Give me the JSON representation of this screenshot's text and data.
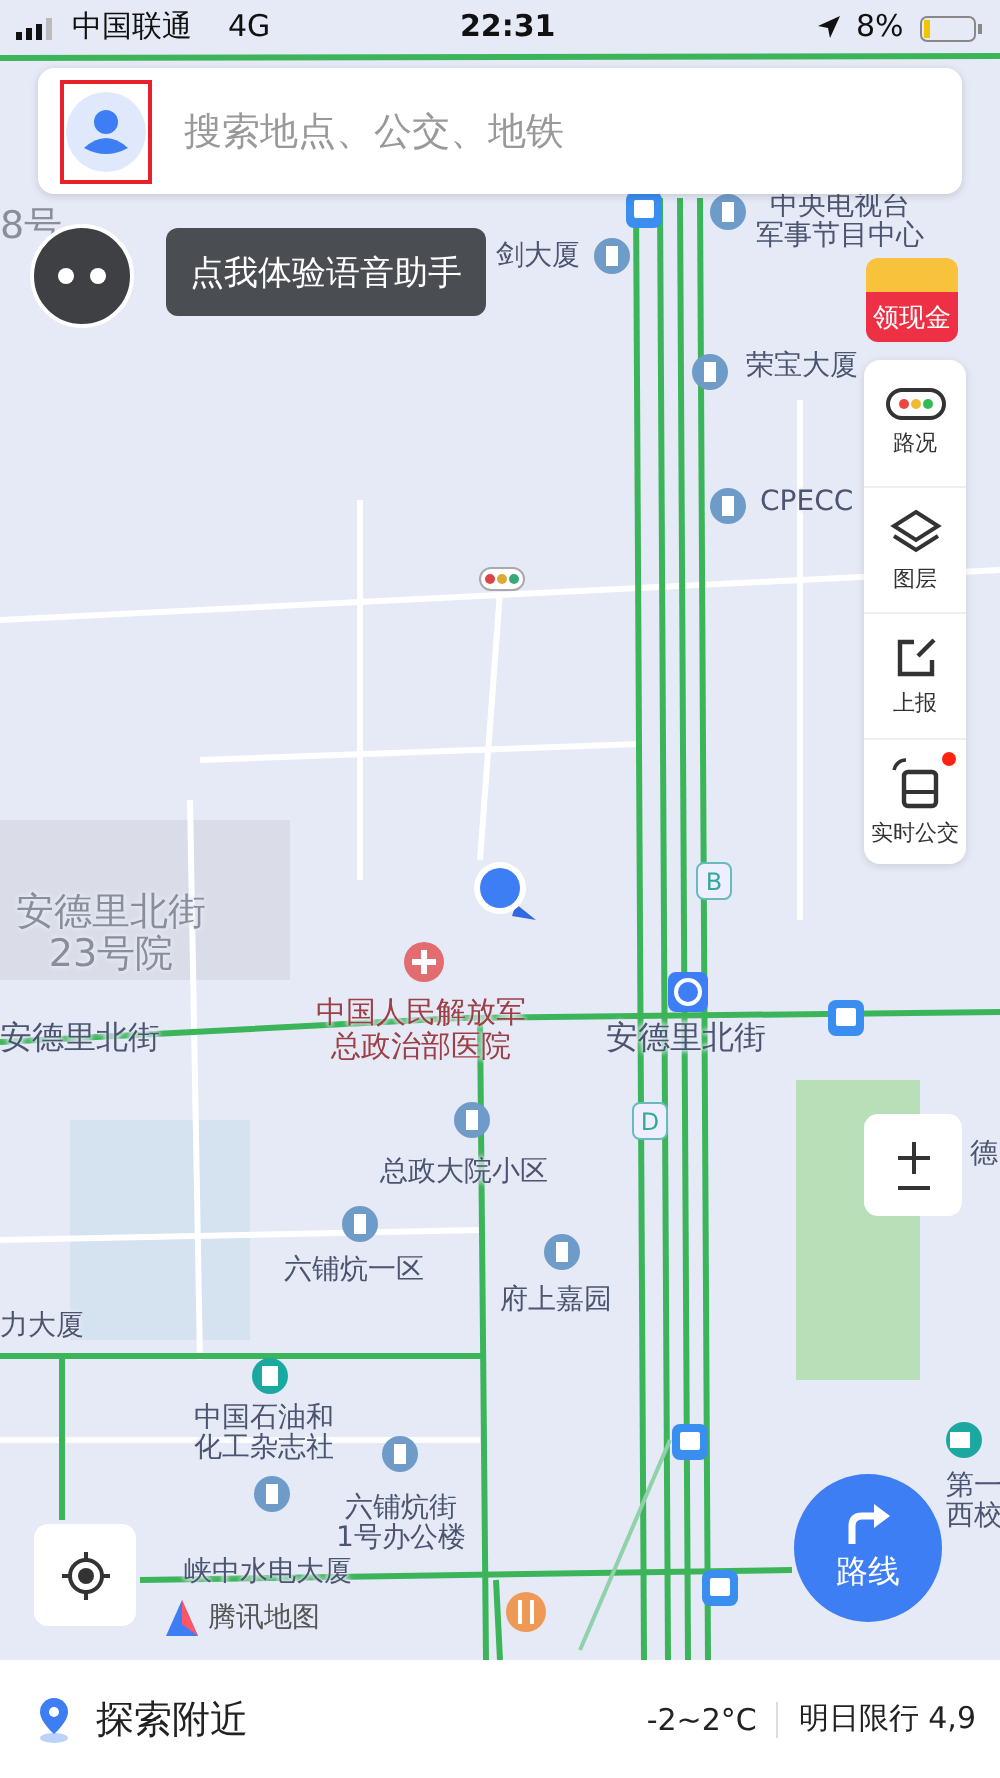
{
  "status_bar": {
    "carrier": "中国联通",
    "network": "4G",
    "time": "22:31",
    "battery": "8%"
  },
  "search": {
    "placeholder": "搜索地点、公交、地铁",
    "avatar_highlighted": true
  },
  "voice_tip": "点我体验语音助手",
  "cash_badge": "领现金",
  "tools": [
    {
      "label": "路况",
      "kind": "traffic",
      "badge": false
    },
    {
      "label": "图层",
      "kind": "layers",
      "badge": false
    },
    {
      "label": "上报",
      "kind": "report",
      "badge": false
    },
    {
      "label": "实时公交",
      "kind": "bus",
      "badge": true
    }
  ],
  "map_labels": [
    {
      "kind": "area",
      "lines": [
        "8号"
      ]
    },
    {
      "kind": "poi",
      "lines": [
        "中央电视台",
        "军事节目中心"
      ]
    },
    {
      "kind": "poi",
      "lines": [
        "剑大厦"
      ]
    },
    {
      "kind": "poi",
      "lines": [
        "荣宝大厦"
      ]
    },
    {
      "kind": "poi",
      "lines": [
        "CPECC"
      ]
    },
    {
      "kind": "area",
      "lines": [
        "安德里北街",
        "23号院"
      ]
    },
    {
      "kind": "street",
      "lines": [
        "安德里北街"
      ]
    },
    {
      "kind": "hospital",
      "lines": [
        "中国人民解放军",
        "总政治部医院"
      ]
    },
    {
      "kind": "street",
      "lines": [
        "安德里北街"
      ]
    },
    {
      "kind": "poi",
      "lines": [
        "总政大院小区"
      ]
    },
    {
      "kind": "poi",
      "lines": [
        "六铺炕一区"
      ]
    },
    {
      "kind": "poi",
      "lines": [
        "府上嘉园"
      ]
    },
    {
      "kind": "poi",
      "lines": [
        "力大厦"
      ]
    },
    {
      "kind": "poi",
      "lines": [
        "中国石油和",
        "化工杂志社"
      ]
    },
    {
      "kind": "poi",
      "lines": [
        "六铺炕街",
        "1号办公楼"
      ]
    },
    {
      "kind": "poi",
      "lines": [
        "峡中水电大厦"
      ]
    },
    {
      "kind": "poi",
      "lines": [
        "德"
      ]
    },
    {
      "kind": "poi",
      "lines": [
        "第一",
        "西校"
      ]
    }
  ],
  "exit_badges": [
    "B",
    "D"
  ],
  "map_logo": "腾讯地图",
  "route_button": "路线",
  "bottom_bar": {
    "explore": "探索附近",
    "weather": "-2~2°C",
    "restriction": "明日限行 4,9"
  }
}
